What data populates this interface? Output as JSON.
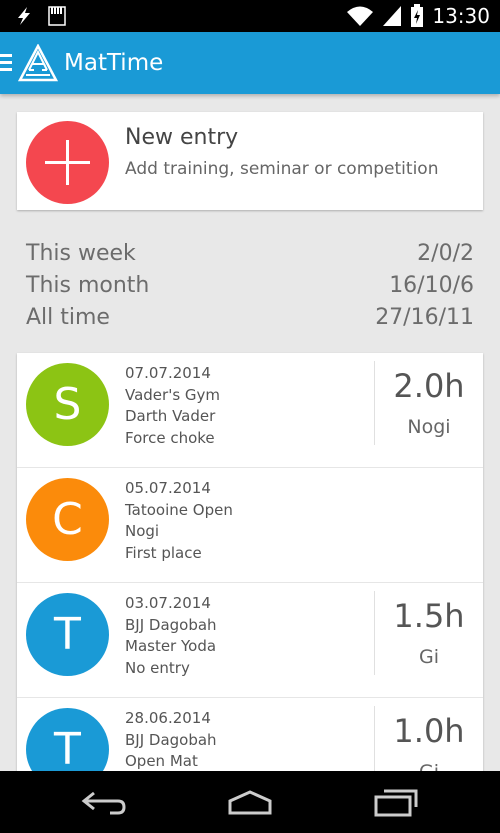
{
  "status_bar": {
    "time": "13:30"
  },
  "app_bar": {
    "title": "MatTime"
  },
  "new_entry": {
    "title": "New entry",
    "subtitle": "Add training, seminar or competition"
  },
  "stats": [
    {
      "label": "This week",
      "value": "2/0/2"
    },
    {
      "label": "This month",
      "value": "16/10/6"
    },
    {
      "label": "All time",
      "value": "27/16/11"
    }
  ],
  "entries": [
    {
      "initial": "S",
      "color": "#8cc414",
      "date": "07.07.2014",
      "line1": "Vader's Gym",
      "line2": "Darth Vader",
      "line3": "Force choke",
      "hours": "2.0h",
      "type": "Nogi"
    },
    {
      "initial": "C",
      "color": "#fb8b0b",
      "date": "05.07.2014",
      "line1": "Tatooine Open",
      "line2": "Nogi",
      "line3": "First place",
      "hours": "",
      "type": ""
    },
    {
      "initial": "T",
      "color": "#1a9ad6",
      "date": "03.07.2014",
      "line1": "BJJ Dagobah",
      "line2": "Master Yoda",
      "line3": "No entry",
      "hours": "1.5h",
      "type": "Gi"
    },
    {
      "initial": "T",
      "color": "#1a9ad6",
      "date": "28.06.2014",
      "line1": "BJJ Dagobah",
      "line2": "Open Mat",
      "line3": "",
      "hours": "1.0h",
      "type": "Gi"
    }
  ],
  "icons": {
    "status_left": [
      "bolt-icon",
      "sd-card-icon"
    ],
    "status_right": [
      "wifi-icon",
      "signal-icon",
      "battery-charging-icon"
    ],
    "nav": [
      "back-icon",
      "home-icon",
      "recents-icon"
    ]
  }
}
